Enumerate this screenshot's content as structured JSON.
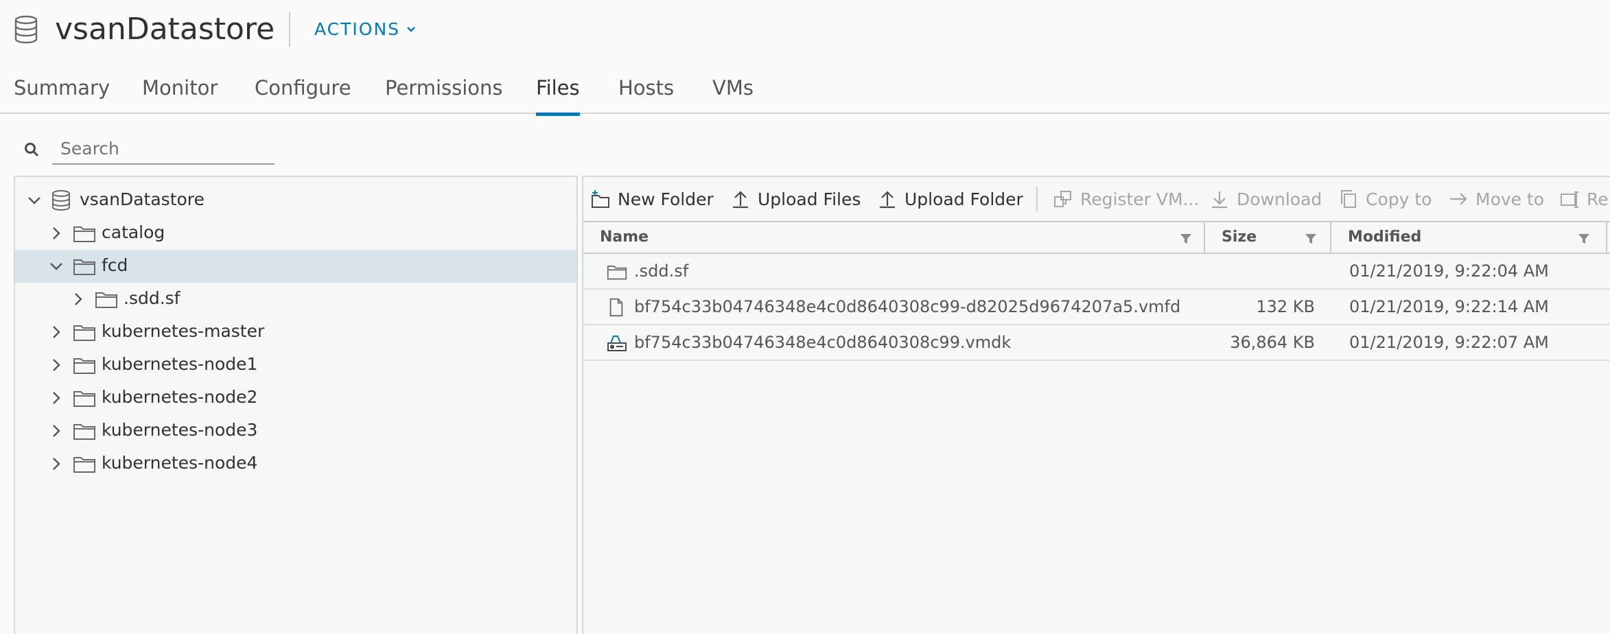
{
  "header": {
    "title": "vsanDatastore",
    "actions_label": "ACTIONS",
    "icon": "datastore-icon"
  },
  "tabs": [
    {
      "label": "Summary",
      "active": false
    },
    {
      "label": "Monitor",
      "active": false
    },
    {
      "label": "Configure",
      "active": false
    },
    {
      "label": "Permissions",
      "active": false
    },
    {
      "label": "Files",
      "active": true
    },
    {
      "label": "Hosts",
      "active": false
    },
    {
      "label": "VMs",
      "active": false
    }
  ],
  "search": {
    "placeholder": "Search",
    "value": ""
  },
  "tree": {
    "root": "vsanDatastore",
    "items": [
      {
        "label": "catalog",
        "expanded": false,
        "selected": false
      },
      {
        "label": "fcd",
        "expanded": true,
        "selected": true
      },
      {
        "label": ".sdd.sf",
        "expanded": false,
        "selected": false
      },
      {
        "label": "kubernetes-master",
        "expanded": false,
        "selected": false
      },
      {
        "label": "kubernetes-node1",
        "expanded": false,
        "selected": false
      },
      {
        "label": "kubernetes-node2",
        "expanded": false,
        "selected": false
      },
      {
        "label": "kubernetes-node3",
        "expanded": false,
        "selected": false
      },
      {
        "label": "kubernetes-node4",
        "expanded": false,
        "selected": false
      }
    ]
  },
  "toolbar": {
    "new_folder": "New Folder",
    "upload_files": "Upload Files",
    "upload_folder": "Upload Folder",
    "register_vm": "Register VM...",
    "download": "Download",
    "copy_to": "Copy to",
    "move_to": "Move to",
    "rename": "Ren"
  },
  "files": {
    "columns": {
      "name": "Name",
      "size": "Size",
      "modified": "Modified"
    },
    "rows": [
      {
        "name": ".sdd.sf",
        "size": "",
        "modified": "01/21/2019, 9:22:04 AM",
        "icon": "folder-icon"
      },
      {
        "name": "bf754c33b04746348e4c0d8640308c99-d82025d9674207a5.vmfd",
        "size": "132 KB",
        "modified": "01/21/2019, 9:22:14 AM",
        "icon": "file-icon"
      },
      {
        "name": "bf754c33b04746348e4c0d8640308c99.vmdk",
        "size": "36,864 KB",
        "modified": "01/21/2019, 9:22:07 AM",
        "icon": "virtual-disk-icon"
      }
    ]
  },
  "colors": {
    "accent": "#0079b8",
    "selected_row": "#d9e4ea",
    "panel_bg": "#f5f8f5",
    "disabled_text": "#a6a6a6"
  }
}
